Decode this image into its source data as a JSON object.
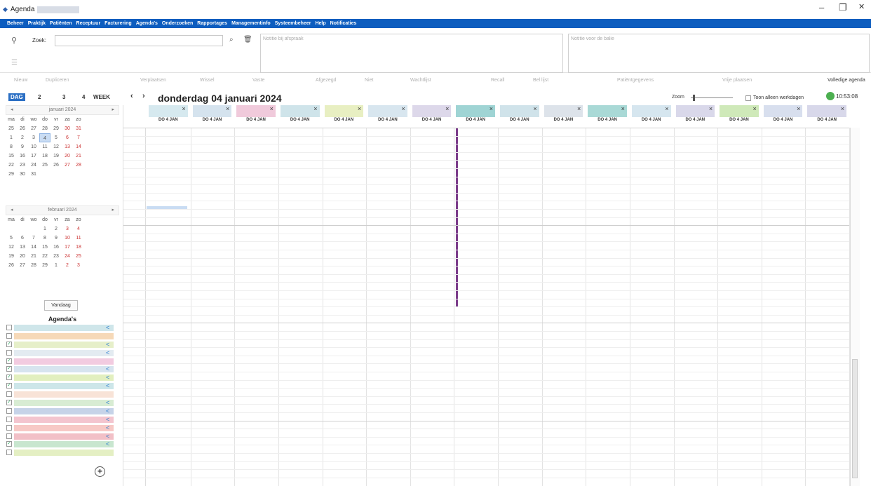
{
  "window": {
    "title": "Agenda",
    "minimize": "–",
    "maximize": "❐",
    "close": "✕"
  },
  "menu": [
    "Beheer",
    "Praktijk",
    "Patiënten",
    "Receptuur",
    "Facturering",
    "Agenda's",
    "Onderzoeken",
    "Rapportages",
    "Managementinfo",
    "Systeembeheer",
    "Help",
    "Notificaties"
  ],
  "search": {
    "label": "Zoek:",
    "placeholder": ""
  },
  "notes": {
    "left_placeholder": "Notitie bij afspraak",
    "right_placeholder": "Notitie voor de balie"
  },
  "toolbar": [
    "Nieuw",
    "Dupliceren",
    "Verplaatsen",
    "Wissel",
    "Vaste",
    "Afgezegd",
    "Niet",
    "Wachtlijst",
    "Recall",
    "Bel lijst",
    "Patiëntgegevens",
    "Vrije plaatsen",
    "Volledige agenda"
  ],
  "views": {
    "day": "DAG",
    "two": "2",
    "three": "3",
    "four": "4",
    "week": "WEEK",
    "prev": "‹",
    "next": "›"
  },
  "date_title": "donderdag 04 januari 2024",
  "zoom_label": "Zoom",
  "workdays_label": "Toon alleen werkdagen",
  "clock": "10:53:08",
  "jan": {
    "title": "januari 2024",
    "weekdays": [
      "ma",
      "di",
      "wo",
      "do",
      "vr",
      "za",
      "zo"
    ],
    "weeks": [
      [
        "25",
        "26",
        "27",
        "28",
        "29",
        "30",
        "31"
      ],
      [
        "1",
        "2",
        "3",
        "4",
        "5",
        "6",
        "7"
      ],
      [
        "8",
        "9",
        "10",
        "11",
        "12",
        "13",
        "14"
      ],
      [
        "15",
        "16",
        "17",
        "18",
        "19",
        "20",
        "21"
      ],
      [
        "22",
        "23",
        "24",
        "25",
        "26",
        "27",
        "28"
      ],
      [
        "29",
        "30",
        "31",
        "",
        "",
        "",
        ""
      ]
    ]
  },
  "feb": {
    "title": "februari 2024",
    "weekdays": [
      "ma",
      "di",
      "wo",
      "do",
      "vr",
      "za",
      "zo"
    ],
    "weeks": [
      [
        "",
        "",
        "",
        "1",
        "2",
        "3",
        "4"
      ],
      [
        "5",
        "6",
        "7",
        "8",
        "9",
        "10",
        "11"
      ],
      [
        "12",
        "13",
        "14",
        "15",
        "16",
        "17",
        "18"
      ],
      [
        "19",
        "20",
        "21",
        "22",
        "23",
        "24",
        "25"
      ],
      [
        "26",
        "27",
        "28",
        "29",
        "1",
        "2",
        "3"
      ]
    ]
  },
  "today_button": "Vandaag",
  "agendas_title": "Agenda's",
  "agenda_colors": [
    "#cfe6ea",
    "#f6d9b8",
    "#e6efc9",
    "#e3ebf1",
    "#f2cbe0",
    "#d7e4ef",
    "#e2efbf",
    "#cde6e9",
    "#f8e3d7",
    "#d8ecd3",
    "#c6d3e8",
    "#f3c5cf",
    "#f7c9c6",
    "#f2c0c7",
    "#c8e6cf",
    "#e4efc3"
  ],
  "agenda_checked": [
    false,
    false,
    true,
    false,
    true,
    true,
    true,
    true,
    false,
    true,
    false,
    false,
    false,
    false,
    true,
    false
  ],
  "columns": [
    {
      "date": "DO 4 JAN",
      "color": "#d6e9ef"
    },
    {
      "date": "DO 4 JAN",
      "color": "#d5e3ee"
    },
    {
      "date": "DO 4 JAN",
      "color": "#f0cadb"
    },
    {
      "date": "DO 4 JAN",
      "color": "#cfe4ea"
    },
    {
      "date": "DO 4 JAN",
      "color": "#e8efc2"
    },
    {
      "date": "DO 4 JAN",
      "color": "#d8e6ef"
    },
    {
      "date": "DO 4 JAN",
      "color": "#ddd8ea"
    },
    {
      "date": "DO 4 JAN",
      "color": "#9fd4d4"
    },
    {
      "date": "DO 4 JAN",
      "color": "#d0e3ea"
    },
    {
      "date": "DO 4 JAN",
      "color": "#dde3ea"
    },
    {
      "date": "DO 4 JAN",
      "color": "#a9d9d6"
    },
    {
      "date": "DO 4 JAN",
      "color": "#d6e6ef"
    },
    {
      "date": "DO 4 JAN",
      "color": "#d9d8ea"
    },
    {
      "date": "DO 4 JAN",
      "color": "#cfe9b9"
    },
    {
      "date": "DO 4 JAN",
      "color": "#d8dfee"
    },
    {
      "date": "DO 4 JAN",
      "color": "#d8d8ea"
    }
  ],
  "add_icon": "+"
}
